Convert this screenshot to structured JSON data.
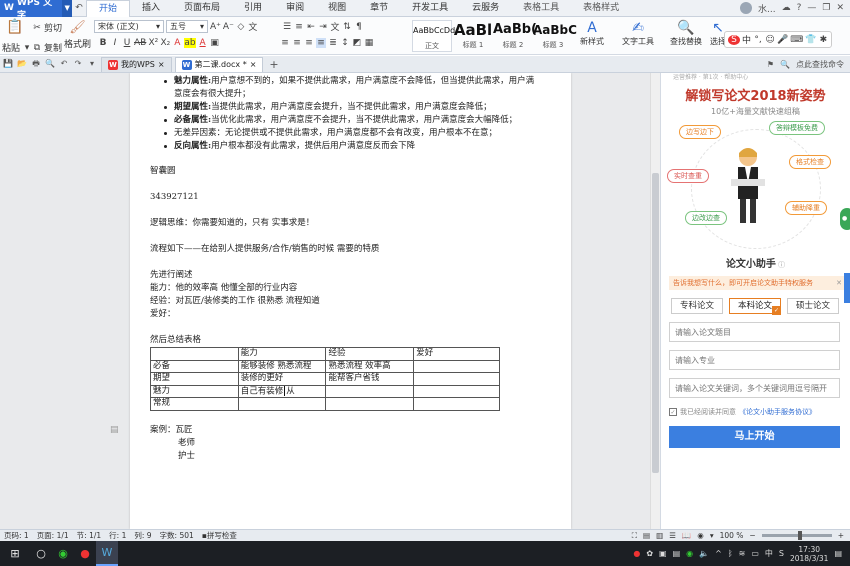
{
  "app": {
    "name": "WPS 文字"
  },
  "menus": [
    "开始",
    "插入",
    "页面布局",
    "引用",
    "审阅",
    "视图",
    "章节",
    "开发工具",
    "云服务"
  ],
  "context_tabs": [
    "表格工具",
    "表格样式"
  ],
  "user": {
    "name": "水..."
  },
  "ribbon": {
    "paste": "粘贴",
    "cut": "剪切",
    "copy": "复制",
    "format_painter": "格式刷",
    "font": "宋体 (正文)",
    "size": "五号",
    "styles": [
      {
        "preview": "AaBbCcDd",
        "label": "正文"
      },
      {
        "preview": "AaBl",
        "label": "标题 1"
      },
      {
        "preview": "AaBb(",
        "label": "标题 2"
      },
      {
        "preview": "AaBbC",
        "label": "标题 3"
      }
    ],
    "new_style": "新样式",
    "text_tools": "文字工具",
    "find_replace": "查找替换",
    "select": "选择",
    "ime": "中"
  },
  "tabs": {
    "home": "我的WPS",
    "doc": "第二课.docx *",
    "search": "点此查找命令"
  },
  "document": {
    "bullets": [
      {
        "term": "魅力属性:",
        "text": "用户意想不到的，如果不提供此需求，用户满意度不会降低，但当提供此需求，用户满意度会有很大提升；"
      },
      {
        "term": "期望属性:",
        "text": "当提供此需求，用户满意度会提升，当不提供此需求，用户满意度会降低；"
      },
      {
        "term": "必备属性:",
        "text": "当优化此需求，用户满意度不会提升，当不提供此需求，用户满意度会大幅降低；"
      },
      {
        "term": "",
        "text": "无差异因素：无论提供或不提供此需求，用户满意度都不会有改变，用户根本不在意；"
      },
      {
        "term": "反向属性:",
        "text": "用户根本都没有此需求，提供后用户满意度反而会下降"
      }
    ],
    "p_name": "智囊圆",
    "p_num": "343927121",
    "p_logic": "逻辑思维：你需要知道的，只有  实事求是！",
    "p_flow": "流程如下——在给别人提供服务/合作/销售的时候  需要的特质",
    "p_first": "先进行阐述",
    "p_ability": "能力：他的效率高  他懂全部的行业内容",
    "p_exp": "经验：对瓦匠/装修类的工作  很熟悉  流程知道",
    "p_hobby": "爱好：",
    "p_summary": "然后总结表格",
    "table": {
      "header": [
        "",
        "能力",
        "经验",
        "爱好"
      ],
      "rows": [
        [
          "必备",
          "能够装修  熟悉流程",
          "熟悉流程  效率高",
          ""
        ],
        [
          "期望",
          "装修的更好",
          "能帮客户省钱",
          ""
        ],
        [
          "魅力",
          "自己有装修",
          "",
          ""
        ],
        [
          "常规",
          "",
          "",
          ""
        ]
      ],
      "cell_tail": "从"
    },
    "case_label": "案例：瓦匠",
    "case_2": "老师",
    "case_3": "护士"
  },
  "panel": {
    "header": "运营推荐 · 第1次 · 帮助中心",
    "title": "解锁写论文2018新姿势",
    "subtitle": "10亿+海量文献快速组稿",
    "features": [
      "边写边下",
      "答辩模板免费",
      "格式检查",
      "实时查重",
      "辅助降重",
      "边改边查"
    ],
    "assistant_title": "论文小助手",
    "promo": "告诉我想写什么，即可开启论文助手特权服务",
    "types": [
      "专科论文",
      "本科论文",
      "硕士论文"
    ],
    "inputs": [
      "请输入论文题目",
      "请输入专业",
      "请输入论文关键词，多个关键词用逗号隔开"
    ],
    "agree_text": "我已经阅读并同意",
    "agree_link": "《论文小助手服务协议》",
    "start": "马上开始"
  },
  "status": {
    "page": "页码: 1",
    "pages": "页面: 1/1",
    "section": "节: 1/1",
    "row": "行: 1",
    "col": "列: 9",
    "words": "字数: 501",
    "spell": "拼写检查",
    "zoom": "100 %",
    "zoom_level": 0.55
  },
  "taskbar": {
    "time": "17:30",
    "date": "2018/3/31",
    "ime": "中"
  },
  "colors": {
    "brand": "#2f6cd2",
    "accent": "#e67e22",
    "button": "#3b7fe0"
  }
}
